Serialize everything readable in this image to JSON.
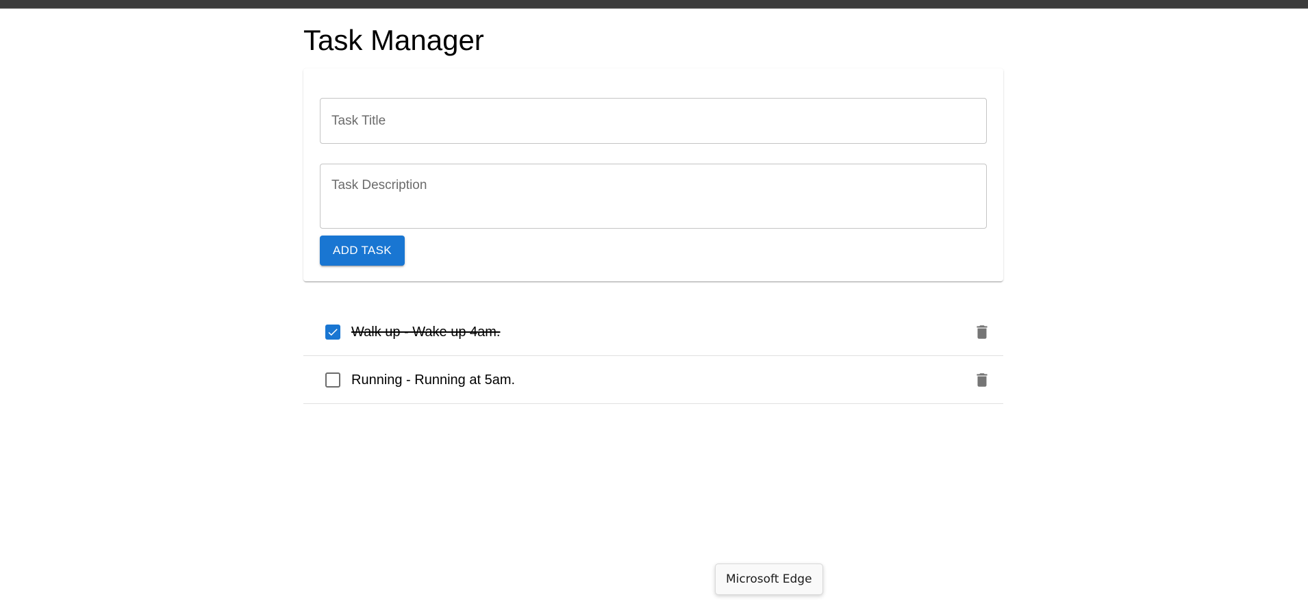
{
  "header": {
    "title": "Task Manager"
  },
  "form": {
    "title_placeholder": "Task Title",
    "title_value": "",
    "description_placeholder": "Task Description",
    "description_value": "",
    "add_button_label": "ADD TASK"
  },
  "tasks": [
    {
      "text": "Walk up - Wake up 4am.",
      "completed": true,
      "delete_icon": "trash-icon"
    },
    {
      "text": "Running - Running at 5am.",
      "completed": false,
      "delete_icon": "trash-icon"
    }
  ],
  "tooltip": {
    "text": "Microsoft Edge"
  },
  "colors": {
    "accent": "#1976d2",
    "icon_gray": "#757575",
    "topbar": "#3c3c3c"
  }
}
